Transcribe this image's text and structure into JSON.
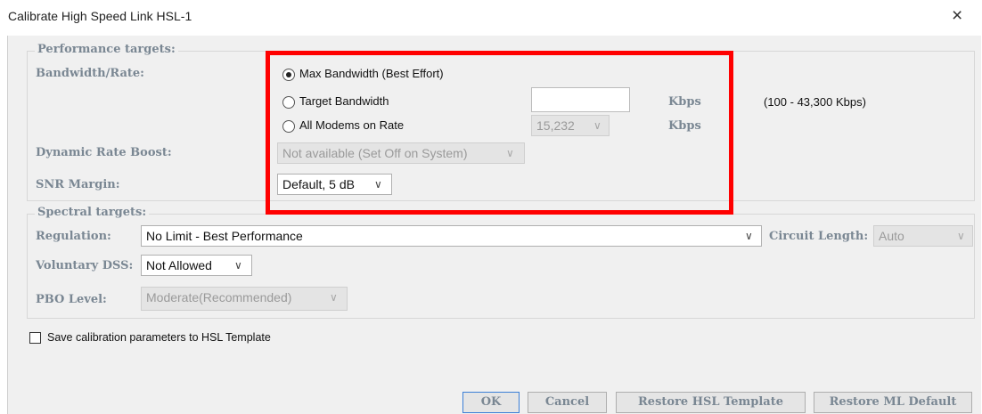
{
  "window": {
    "title": "Calibrate High Speed Link HSL-1",
    "close_glyph": "×"
  },
  "performance": {
    "legend": "Performance targets:",
    "bandwidth_label": "Bandwidth/Rate:",
    "options": {
      "max": {
        "label": "Max Bandwidth (Best Effort)",
        "selected": true
      },
      "target": {
        "label": "Target Bandwidth",
        "selected": false,
        "unit": "Kbps",
        "range": "(100 - 43,300 Kbps)"
      },
      "all_modems": {
        "label": "All Modems on Rate",
        "selected": false,
        "value": "15,232",
        "unit": "Kbps"
      }
    },
    "dynamic_boost_label": "Dynamic Rate Boost:",
    "dynamic_boost_value": "Not available (Set Off on System)",
    "snr_label": "SNR Margin:",
    "snr_value": "Default, 5 dB"
  },
  "spectral": {
    "legend": "Spectral targets:",
    "regulation_label": "Regulation:",
    "regulation_value": "No Limit - Best Performance",
    "circuit_length_label": "Circuit Length:",
    "circuit_length_value": "Auto",
    "voluntary_dss_label": "Voluntary DSS:",
    "voluntary_dss_value": "Not Allowed",
    "pbo_label": "PBO Level:",
    "pbo_value": "Moderate(Recommended)"
  },
  "save_template": {
    "label": "Save calibration parameters to HSL Template",
    "checked": false
  },
  "buttons": {
    "ok": "OK",
    "cancel": "Cancel",
    "restore_hsl": "Restore HSL Template",
    "restore_ml": "Restore ML Default"
  },
  "icons": {
    "chevron": "∨"
  },
  "colors": {
    "highlight": "#ff0000",
    "label": "#7a8793",
    "ok_border": "#3c7fd6"
  }
}
